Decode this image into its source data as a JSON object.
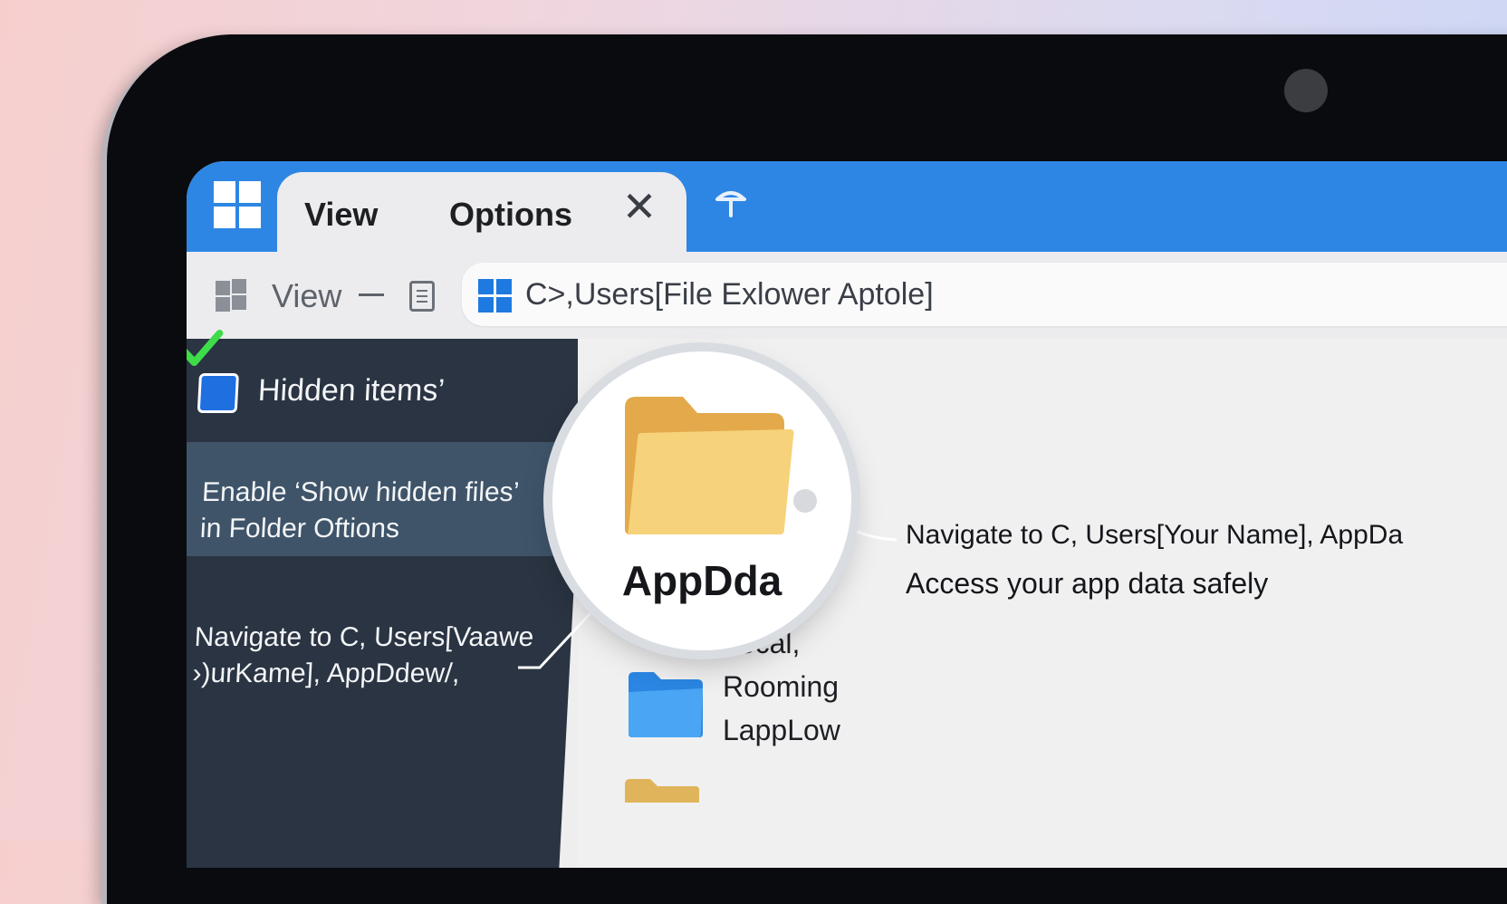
{
  "window": {
    "tab_view": "View",
    "tab_options": "Options",
    "close_glyph": "✕"
  },
  "toolbar": {
    "view_label": "View",
    "address_path": "C>,Users[File Exlower Aptole]"
  },
  "sidebar": {
    "hidden_items_label": "Hidden items’",
    "hidden_items_checked": true,
    "enable_line1": "Enable ‘Show hidden files’",
    "enable_line2": "in Folder Oftions",
    "navigate_line1": "Navigate to C, Users[Vaawe",
    "navigate_line2": "›)urKame], AppDdew/,"
  },
  "magnifier": {
    "folder_label": "AppDda"
  },
  "content": {
    "folders": [
      {
        "label": "Local,",
        "icon": "folder-icon"
      },
      {
        "label": "Rooming",
        "icon": "folder-icon"
      },
      {
        "label": "LappLow",
        "icon": "folder-icon"
      }
    ],
    "description_line1": "Navigate to C, Users[Your Name], AppDa",
    "description_line2": "Access your app data safely"
  },
  "colors": {
    "titlebar": "#2e86e4",
    "sidebar": "#2a3442",
    "sidebar_highlight": "#3f5469",
    "folder_yellow": "#f6d27a",
    "folder_blue": "#3b9bf0",
    "checkbox": "#1e6fe0",
    "checkmark": "#3fdc4a"
  }
}
